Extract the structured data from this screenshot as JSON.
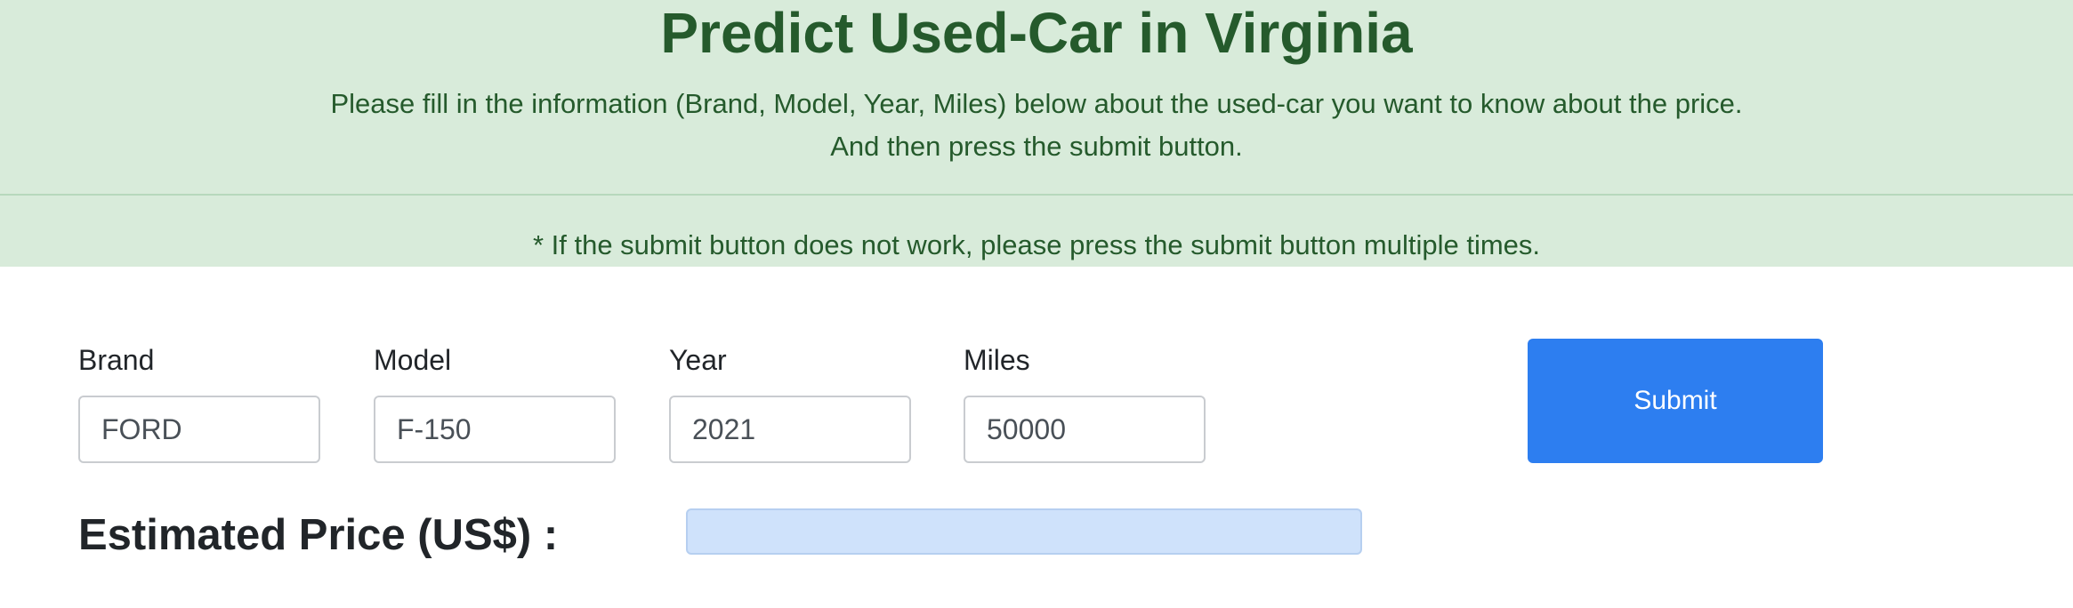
{
  "header": {
    "title": "Predict Used-Car in Virginia",
    "description_line1": "Please fill in the information (Brand, Model, Year, Miles) below about the used-car you want to know about the price.",
    "description_line2": "And then press the submit button.",
    "note": "* If the submit button does not work, please press the submit button multiple times."
  },
  "form": {
    "brand": {
      "label": "Brand",
      "value": "FORD"
    },
    "model": {
      "label": "Model",
      "value": "F-150"
    },
    "year": {
      "label": "Year",
      "value": "2021"
    },
    "miles": {
      "label": "Miles",
      "value": "50000"
    },
    "submit_label": "Submit"
  },
  "result": {
    "label": "Estimated Price (US$) :",
    "value": ""
  },
  "colors": {
    "banner_bg": "#d8ebda",
    "banner_text": "#255a2c",
    "submit_bg": "#2d7ef0",
    "result_bg": "#cfe2fb"
  }
}
